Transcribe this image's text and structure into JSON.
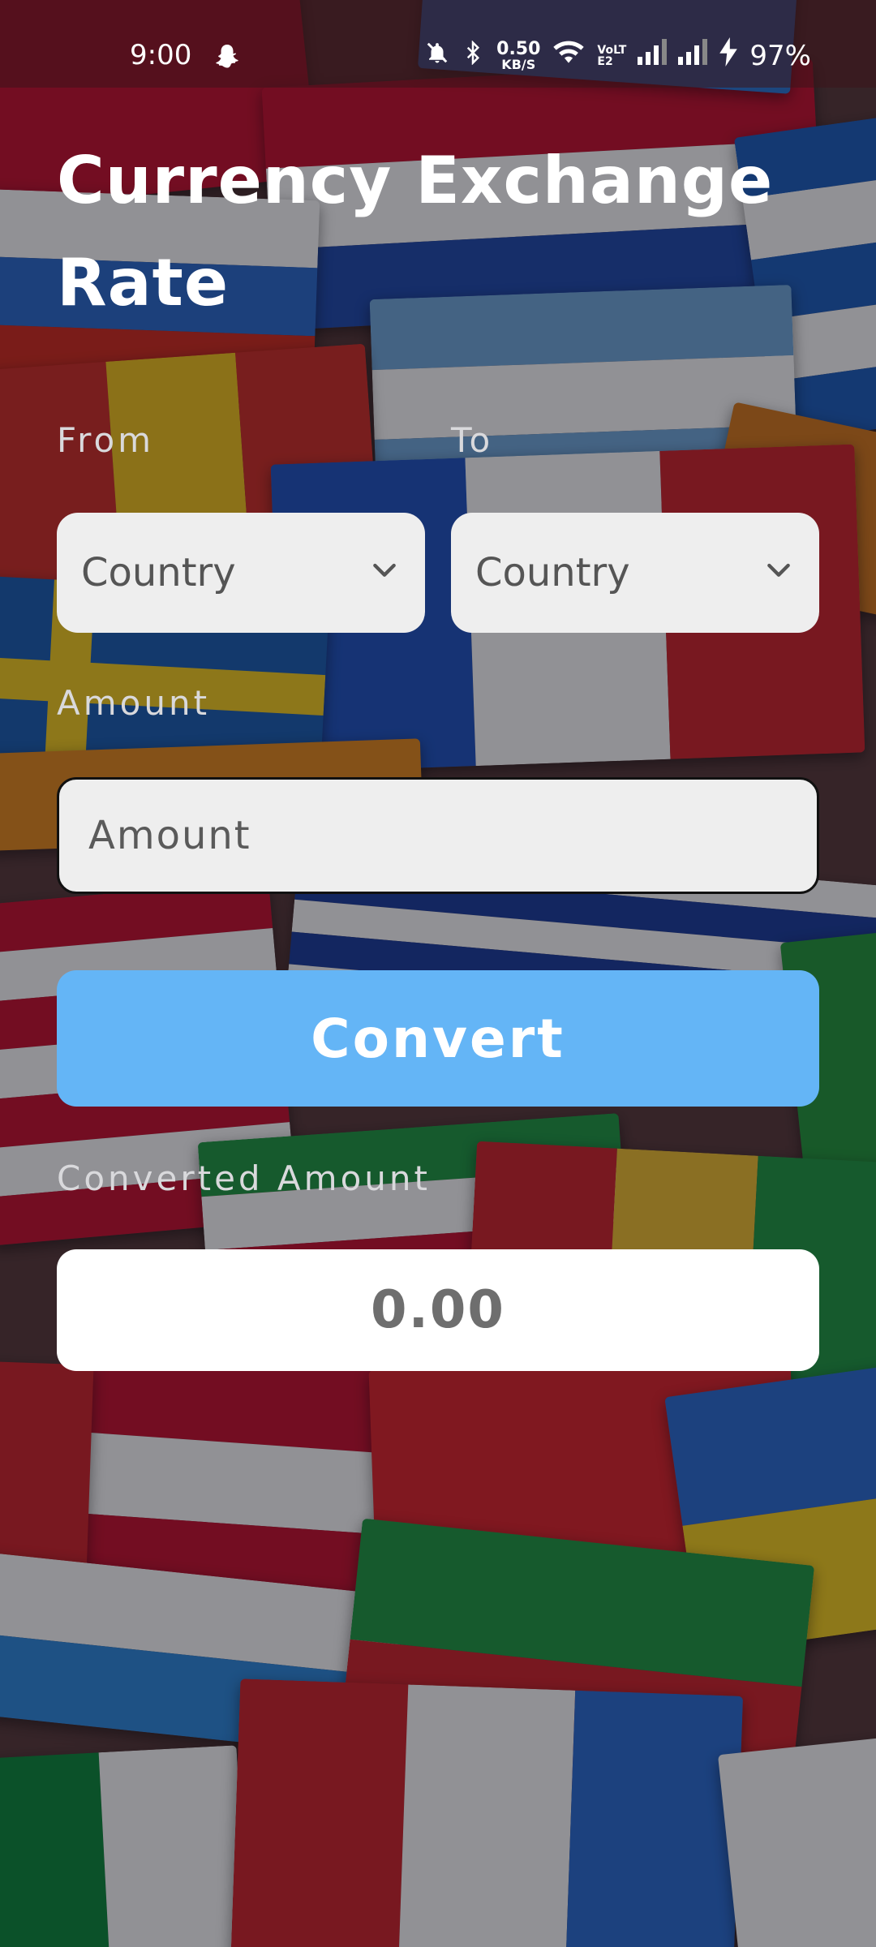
{
  "status_bar": {
    "time": "9:00",
    "speed_value": "0.50",
    "speed_unit": "KB/S",
    "network_label": "VoLTE2",
    "battery": "97%",
    "icons": [
      "snapchat-ghost-icon",
      "mute-bell-icon",
      "bluetooth-icon",
      "wifi-icon",
      "signal-icon",
      "signal-icon",
      "charging-icon"
    ]
  },
  "page": {
    "title": "Currency Exchange Rate",
    "from_label": "From",
    "to_label": "To",
    "from_select": {
      "value": "Country",
      "icon": "chevron-down-icon"
    },
    "to_select": {
      "value": "Country",
      "icon": "chevron-down-icon"
    },
    "amount_label": "Amount",
    "amount_input": {
      "value": "",
      "placeholder": "Amount"
    },
    "convert_label": "Convert",
    "converted_label": "Converted Amount",
    "converted_value": "0.00"
  },
  "colors": {
    "accent": "#64b5f6",
    "field_bg": "#eeeeee",
    "result_bg": "#ffffff"
  }
}
